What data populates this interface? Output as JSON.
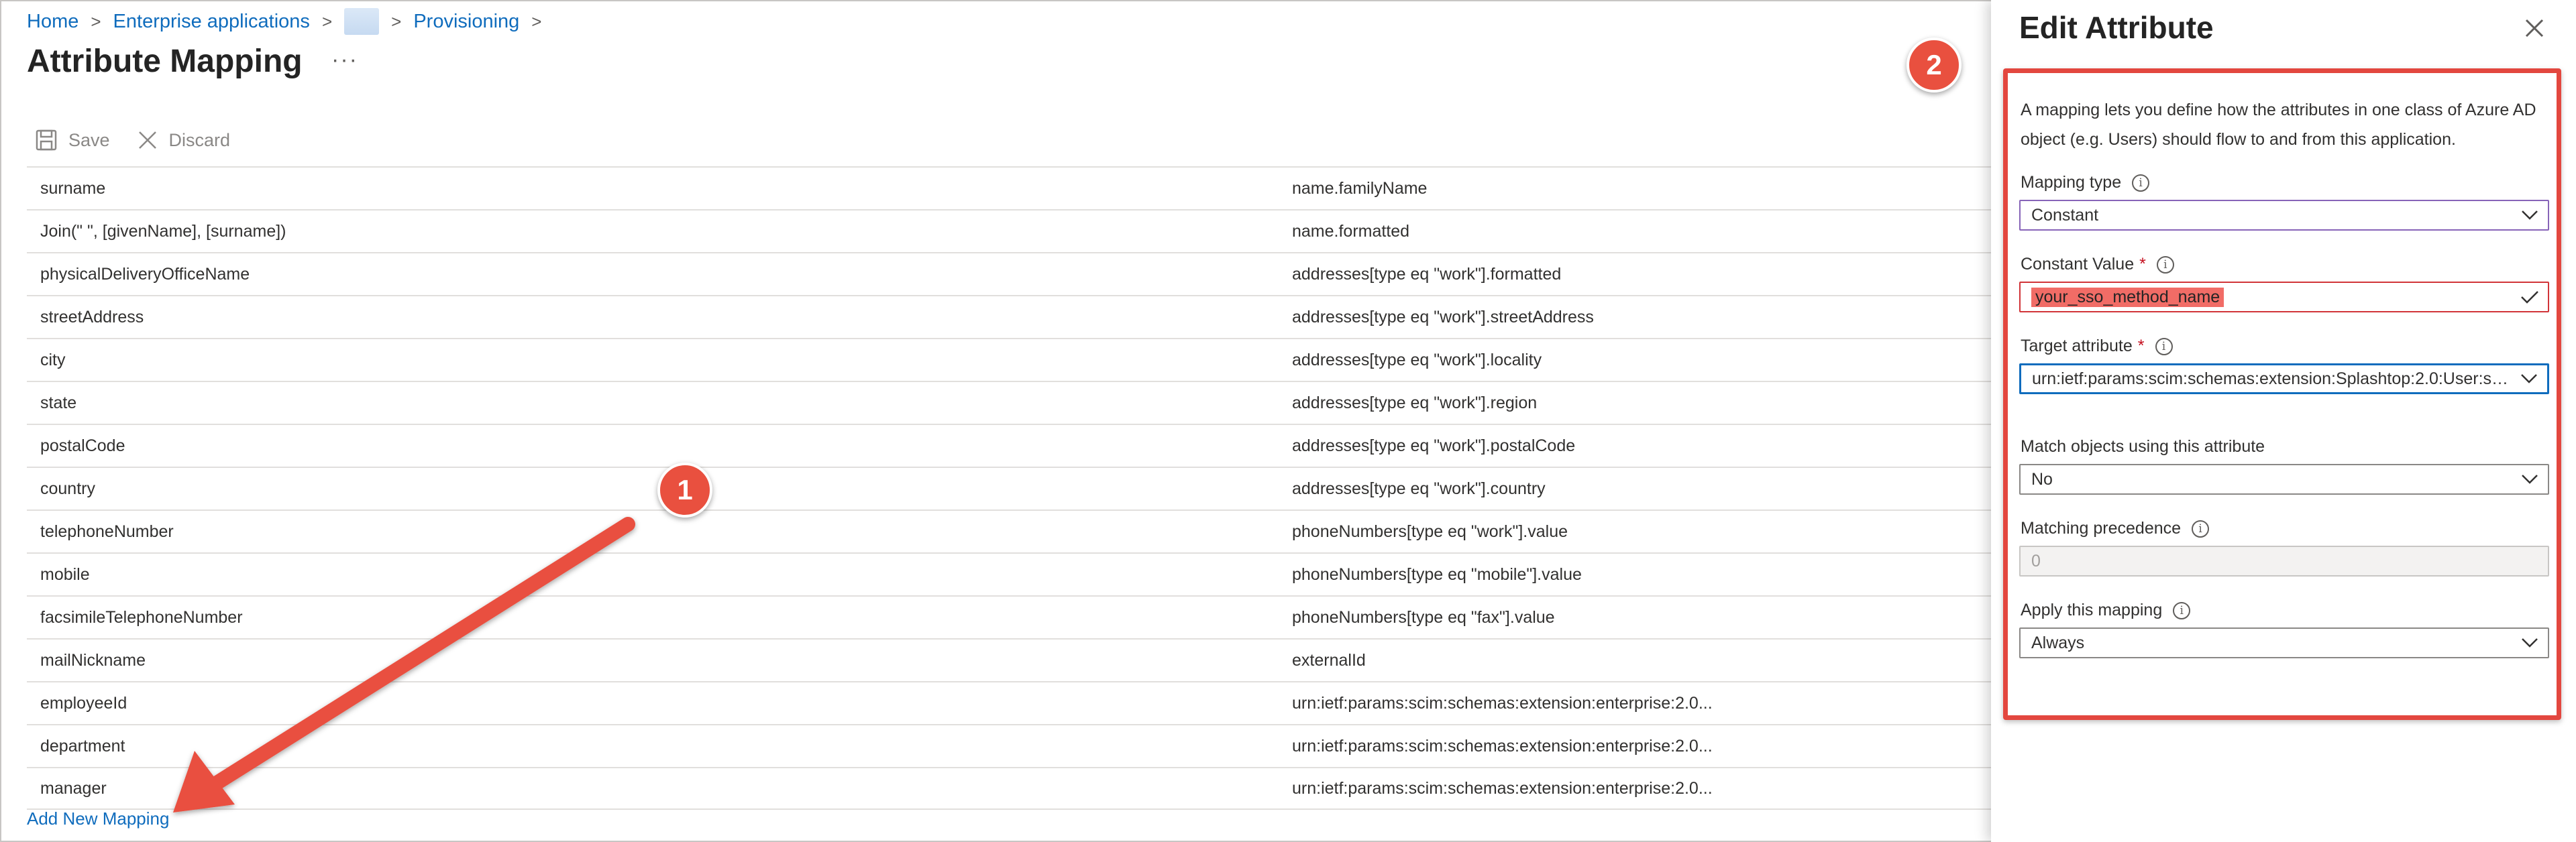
{
  "breadcrumb": {
    "home": "Home",
    "enterprise": "Enterprise applications",
    "provisioning": "Provisioning"
  },
  "page": {
    "title": "Attribute Mapping",
    "more": "···"
  },
  "toolbar": {
    "save": "Save",
    "discard": "Discard"
  },
  "mappings": [
    {
      "source": "surname",
      "target": "name.familyName"
    },
    {
      "source": "Join(\" \", [givenName], [surname])",
      "target": "name.formatted"
    },
    {
      "source": "physicalDeliveryOfficeName",
      "target": "addresses[type eq \"work\"].formatted"
    },
    {
      "source": "streetAddress",
      "target": "addresses[type eq \"work\"].streetAddress"
    },
    {
      "source": "city",
      "target": "addresses[type eq \"work\"].locality"
    },
    {
      "source": "state",
      "target": "addresses[type eq \"work\"].region"
    },
    {
      "source": "postalCode",
      "target": "addresses[type eq \"work\"].postalCode"
    },
    {
      "source": "country",
      "target": "addresses[type eq \"work\"].country"
    },
    {
      "source": "telephoneNumber",
      "target": "phoneNumbers[type eq \"work\"].value"
    },
    {
      "source": "mobile",
      "target": "phoneNumbers[type eq \"mobile\"].value"
    },
    {
      "source": "facsimileTelephoneNumber",
      "target": "phoneNumbers[type eq \"fax\"].value"
    },
    {
      "source": "mailNickname",
      "target": "externalId"
    },
    {
      "source": "employeeId",
      "target": "urn:ietf:params:scim:schemas:extension:enterprise:2.0..."
    },
    {
      "source": "department",
      "target": "urn:ietf:params:scim:schemas:extension:enterprise:2.0..."
    },
    {
      "source": "manager",
      "target": "urn:ietf:params:scim:schemas:extension:enterprise:2.0..."
    }
  ],
  "add_mapping": "Add New Mapping",
  "panel": {
    "title": "Edit Attribute",
    "description": "A mapping lets you define how the attributes in one class of Azure AD object (e.g. Users) should flow to and from this application.",
    "mapping_type": {
      "label": "Mapping type",
      "value": "Constant"
    },
    "constant_value": {
      "label": "Constant Value",
      "required": "*",
      "value": "your_sso_method_name"
    },
    "target_attribute": {
      "label": "Target attribute",
      "required": "*",
      "value": "urn:ietf:params:scim:schemas:extension:Splashtop:2.0:User:ss..."
    },
    "match_objects": {
      "label": "Match objects using this attribute",
      "value": "No"
    },
    "matching_precedence": {
      "label": "Matching precedence",
      "value": "0"
    },
    "apply_mapping": {
      "label": "Apply this mapping",
      "value": "Always"
    }
  },
  "markers": {
    "one": "1",
    "two": "2"
  },
  "colors": {
    "accent": "#0f6cbd",
    "annotation": "#e9503f",
    "error": "#d13438"
  },
  "icons": [
    "save-icon",
    "discard-icon",
    "close-icon",
    "info-icon",
    "chevron-down-icon",
    "checkmark-icon"
  ]
}
